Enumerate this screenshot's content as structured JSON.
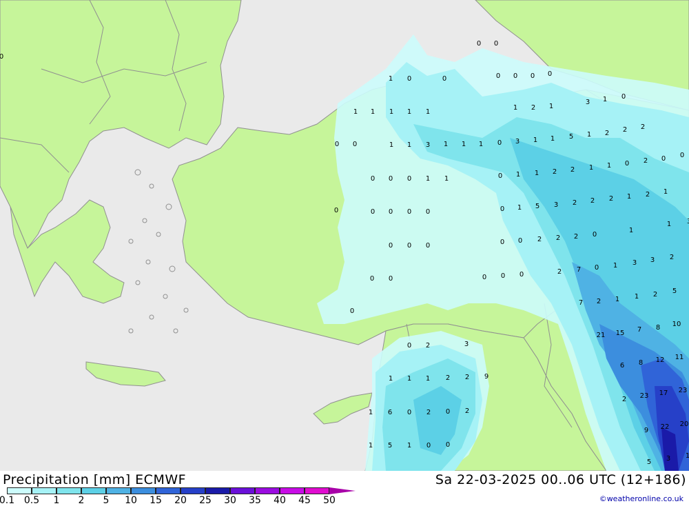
{
  "header": {
    "title_left": "Precipitation [mm] ECMWF",
    "title_right": "Sa 22-03-2025 00..06 UTC (12+186)"
  },
  "credit": "©weatheronline.co.uk",
  "legend": {
    "items": [
      {
        "label": "0.1",
        "color": "#ccfcfc"
      },
      {
        "label": "0.5",
        "color": "#a6f2f6"
      },
      {
        "label": "1",
        "color": "#7fe4ec"
      },
      {
        "label": "2",
        "color": "#5cd0e6"
      },
      {
        "label": "5",
        "color": "#4fb2e4"
      },
      {
        "label": "10",
        "color": "#3c8ede"
      },
      {
        "label": "15",
        "color": "#3064d8"
      },
      {
        "label": "20",
        "color": "#2640c8"
      },
      {
        "label": "25",
        "color": "#1a1aa8"
      },
      {
        "label": "30",
        "color": "#6a10d8"
      },
      {
        "label": "35",
        "color": "#9a0ce0"
      },
      {
        "label": "40",
        "color": "#c80ce6"
      },
      {
        "label": "45",
        "color": "#e00cd0"
      },
      {
        "label": "50",
        "color": "#a800a8"
      }
    ]
  },
  "colors": {
    "sea": "#eaeaea",
    "land": "#c6f59a",
    "border": "#909090"
  },
  "map_values": [
    {
      "v": "0"
    },
    {
      "v": "0"
    },
    {
      "v": "0"
    },
    {
      "v": "0"
    },
    {
      "v": "0"
    },
    {
      "v": "0"
    },
    {
      "v": "0"
    },
    {
      "v": "1"
    },
    {
      "v": "0"
    },
    {
      "v": "0"
    },
    {
      "v": "1"
    },
    {
      "v": "2"
    },
    {
      "v": "1"
    },
    {
      "v": "3"
    },
    {
      "v": "1"
    },
    {
      "v": "0"
    },
    {
      "v": "1"
    },
    {
      "v": "1"
    },
    {
      "v": "1"
    },
    {
      "v": "1"
    },
    {
      "v": "1"
    },
    {
      "v": "0"
    },
    {
      "v": "0"
    },
    {
      "v": "1"
    },
    {
      "v": "1"
    },
    {
      "v": "3"
    },
    {
      "v": "1"
    },
    {
      "v": "1"
    },
    {
      "v": "1"
    },
    {
      "v": "0"
    },
    {
      "v": "3"
    },
    {
      "v": "1"
    },
    {
      "v": "1"
    },
    {
      "v": "5"
    },
    {
      "v": "1"
    },
    {
      "v": "2"
    },
    {
      "v": "2"
    },
    {
      "v": "2"
    },
    {
      "v": "0"
    },
    {
      "v": "0"
    },
    {
      "v": "0"
    },
    {
      "v": "1"
    },
    {
      "v": "1"
    },
    {
      "v": "0"
    },
    {
      "v": "1"
    },
    {
      "v": "1"
    },
    {
      "v": "2"
    },
    {
      "v": "2"
    },
    {
      "v": "1"
    },
    {
      "v": "1"
    },
    {
      "v": "0"
    },
    {
      "v": "2"
    },
    {
      "v": "0"
    },
    {
      "v": "0"
    },
    {
      "v": "0"
    },
    {
      "v": "0"
    },
    {
      "v": "0"
    },
    {
      "v": "0"
    },
    {
      "v": "0"
    },
    {
      "v": "0"
    },
    {
      "v": "1"
    },
    {
      "v": "5"
    },
    {
      "v": "3"
    },
    {
      "v": "2"
    },
    {
      "v": "2"
    },
    {
      "v": "2"
    },
    {
      "v": "1"
    },
    {
      "v": "2"
    },
    {
      "v": "1"
    },
    {
      "v": "0"
    },
    {
      "v": "0"
    },
    {
      "v": "0"
    },
    {
      "v": "0"
    },
    {
      "v": "0"
    },
    {
      "v": "2"
    },
    {
      "v": "2"
    },
    {
      "v": "2"
    },
    {
      "v": "0"
    },
    {
      "v": "1"
    },
    {
      "v": "1"
    },
    {
      "v": "3"
    },
    {
      "v": "0"
    },
    {
      "v": "0"
    },
    {
      "v": "0"
    },
    {
      "v": "0"
    },
    {
      "v": "0"
    },
    {
      "v": "2"
    },
    {
      "v": "7"
    },
    {
      "v": "0"
    },
    {
      "v": "1"
    },
    {
      "v": "3"
    },
    {
      "v": "3"
    },
    {
      "v": "2"
    },
    {
      "v": "0"
    },
    {
      "v": "7"
    },
    {
      "v": "2"
    },
    {
      "v": "1"
    },
    {
      "v": "1"
    },
    {
      "v": "2"
    },
    {
      "v": "5"
    },
    {
      "v": "21"
    },
    {
      "v": "15"
    },
    {
      "v": "7"
    },
    {
      "v": "8"
    },
    {
      "v": "10"
    },
    {
      "v": "0"
    },
    {
      "v": "2"
    },
    {
      "v": "3"
    },
    {
      "v": "6"
    },
    {
      "v": "8"
    },
    {
      "v": "12"
    },
    {
      "v": "11"
    },
    {
      "v": "1"
    },
    {
      "v": "1"
    },
    {
      "v": "1"
    },
    {
      "v": "2"
    },
    {
      "v": "2"
    },
    {
      "v": "9"
    },
    {
      "v": "2"
    },
    {
      "v": "23"
    },
    {
      "v": "17"
    },
    {
      "v": "23"
    },
    {
      "v": "1"
    },
    {
      "v": "6"
    },
    {
      "v": "0"
    },
    {
      "v": "2"
    },
    {
      "v": "0"
    },
    {
      "v": "2"
    },
    {
      "v": "9"
    },
    {
      "v": "22"
    },
    {
      "v": "20"
    },
    {
      "v": "1"
    },
    {
      "v": "5"
    },
    {
      "v": "1"
    },
    {
      "v": "0"
    },
    {
      "v": "0"
    },
    {
      "v": "5"
    },
    {
      "v": "3"
    },
    {
      "v": "1"
    }
  ]
}
